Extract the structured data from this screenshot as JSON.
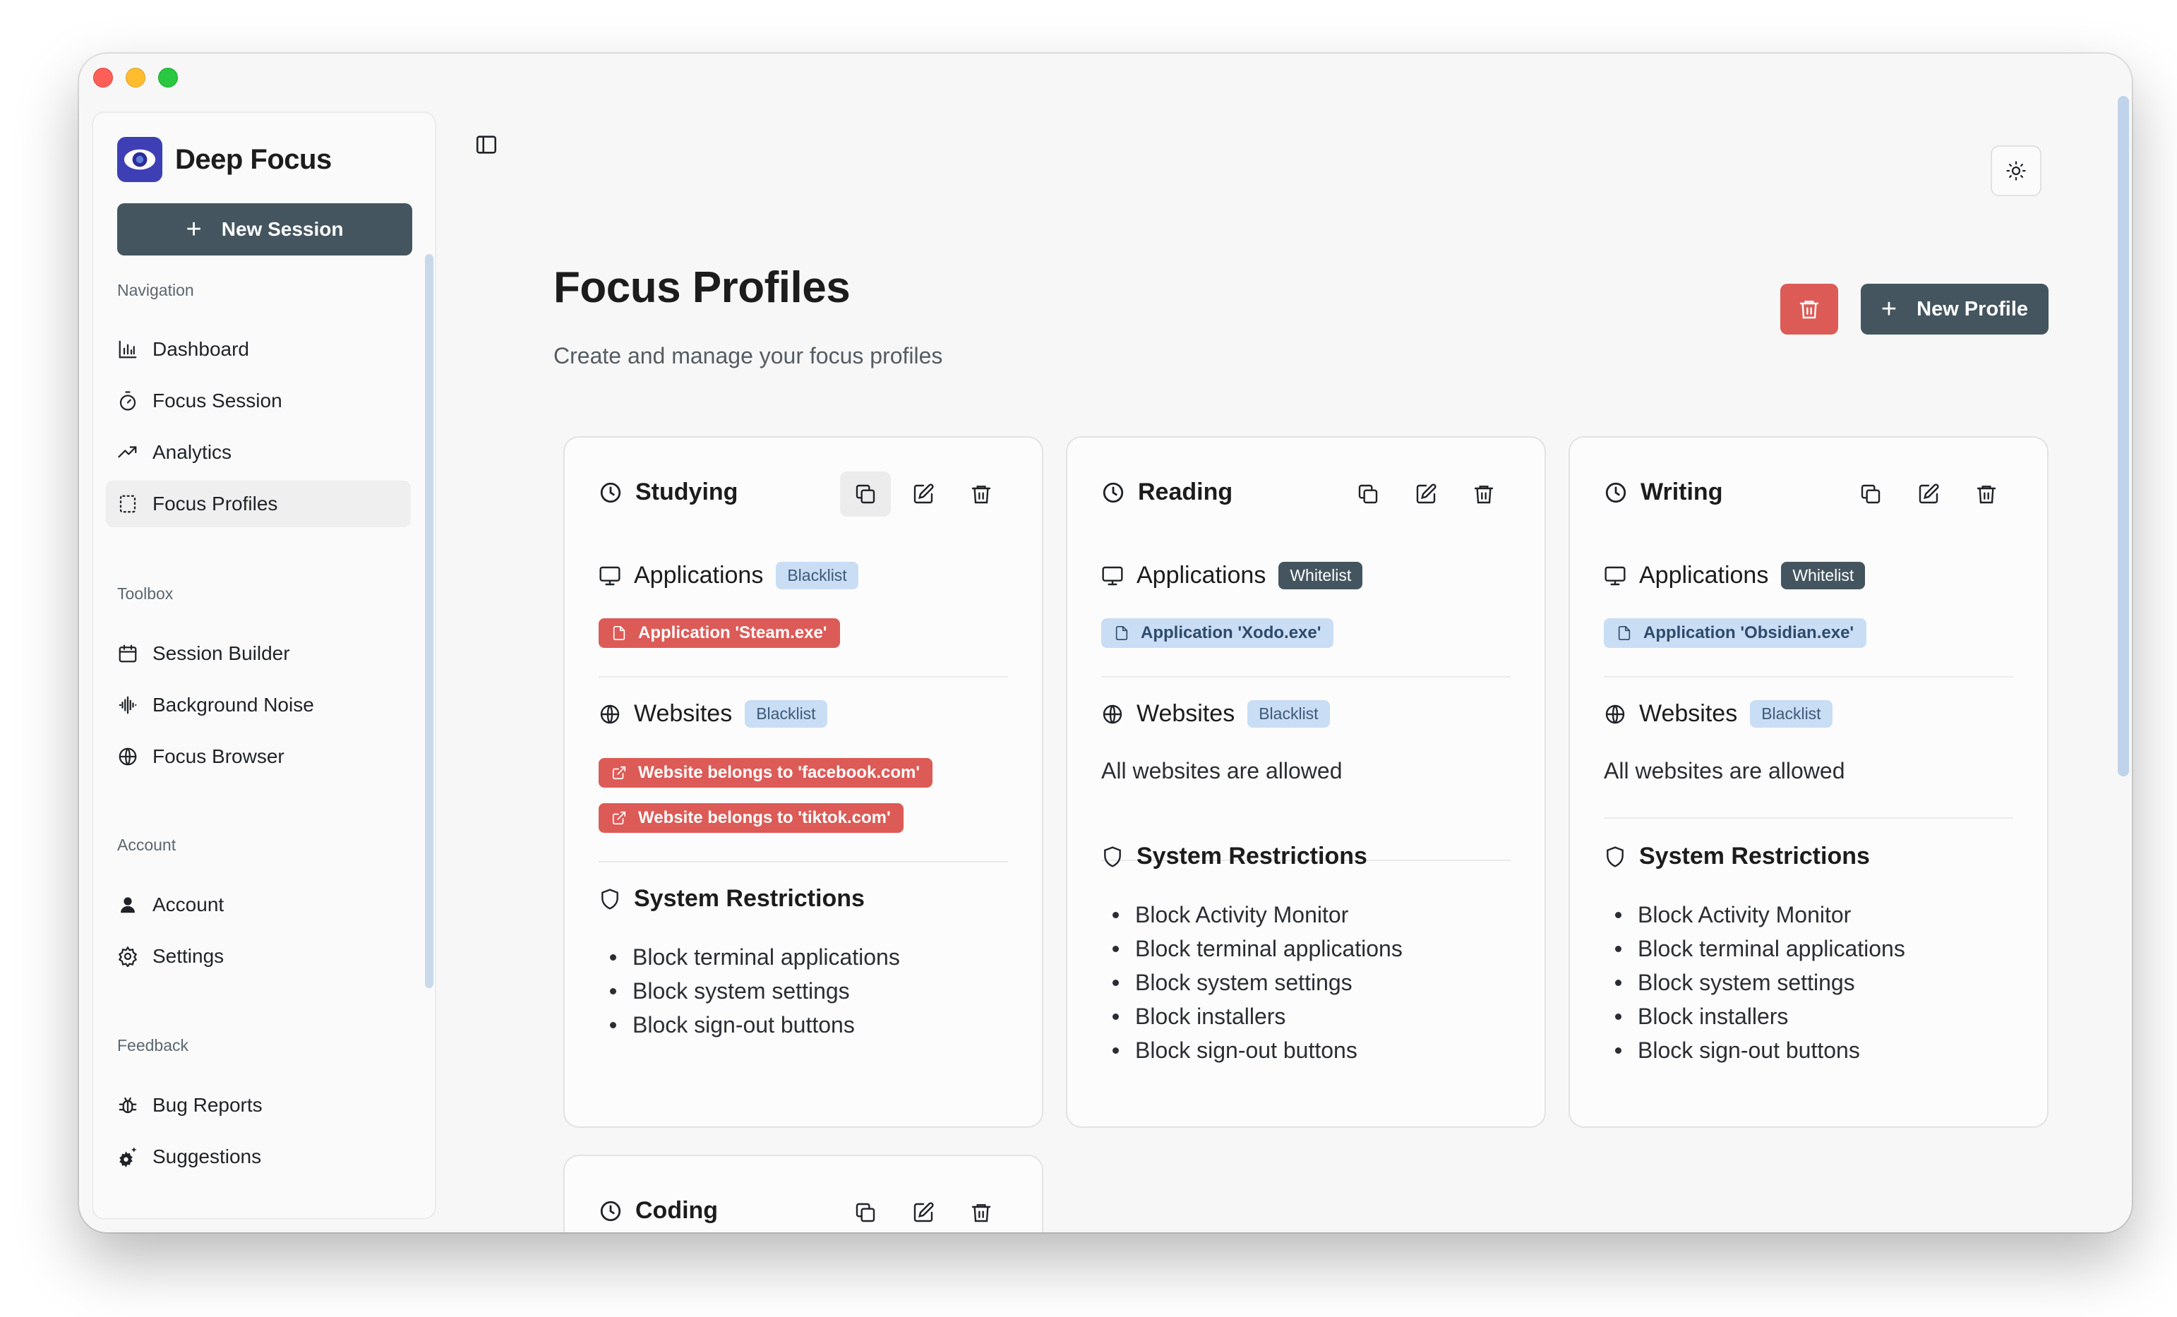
{
  "app": {
    "name": "Deep Focus"
  },
  "sidebar": {
    "new_session_label": "New Session",
    "sections": {
      "navigation": "Navigation",
      "toolbox": "Toolbox",
      "account": "Account",
      "feedback": "Feedback"
    },
    "items": [
      {
        "label": "Dashboard",
        "icon": "bar-chart-icon"
      },
      {
        "label": "Focus Session",
        "icon": "timer-icon"
      },
      {
        "label": "Analytics",
        "icon": "trend-icon"
      },
      {
        "label": "Focus Profiles",
        "icon": "profile-frame-icon",
        "active": true
      },
      {
        "label": "Session Builder",
        "icon": "calendar-icon"
      },
      {
        "label": "Background Noise",
        "icon": "audio-wave-icon"
      },
      {
        "label": "Focus Browser",
        "icon": "globe-icon"
      },
      {
        "label": "Account",
        "icon": "user-icon"
      },
      {
        "label": "Settings",
        "icon": "gear-icon"
      },
      {
        "label": "Bug Reports",
        "icon": "bug-icon"
      },
      {
        "label": "Suggestions",
        "icon": "sparkle-gear-icon"
      }
    ]
  },
  "header": {
    "title": "Focus Profiles",
    "subtitle": "Create and manage your focus profiles",
    "new_profile_label": "New Profile"
  },
  "labels": {
    "applications": "Applications",
    "websites": "Websites",
    "system_restrictions": "System Restrictions",
    "blacklist": "Blacklist",
    "whitelist": "Whitelist",
    "all_websites_allowed": "All websites are allowed"
  },
  "profiles": [
    {
      "name": "Studying",
      "applications_mode": "Blacklist",
      "applications": [
        "Application 'Steam.exe'"
      ],
      "websites_mode": "Blacklist",
      "websites": [
        "Website belongs to 'facebook.com'",
        "Website belongs to 'tiktok.com'"
      ],
      "restrictions": [
        "Block terminal applications",
        "Block system settings",
        "Block sign-out buttons"
      ]
    },
    {
      "name": "Reading",
      "applications_mode": "Whitelist",
      "applications": [
        "Application 'Xodo.exe'"
      ],
      "websites_mode": "Blacklist",
      "websites_text": "All websites are allowed",
      "restrictions": [
        "Block Activity Monitor",
        "Block terminal applications",
        "Block system settings",
        "Block installers",
        "Block sign-out buttons"
      ]
    },
    {
      "name": "Writing",
      "applications_mode": "Whitelist",
      "applications": [
        "Application 'Obsidian.exe'"
      ],
      "websites_mode": "Blacklist",
      "websites_text": "All websites are allowed",
      "restrictions": [
        "Block Activity Monitor",
        "Block terminal applications",
        "Block system settings",
        "Block installers",
        "Block sign-out buttons"
      ]
    },
    {
      "name": "Coding"
    }
  ],
  "colors": {
    "accent": "#44555f",
    "danger": "#dc5b57",
    "badge_blue": "#c9ddf5",
    "brand": "#3f3fb5"
  }
}
